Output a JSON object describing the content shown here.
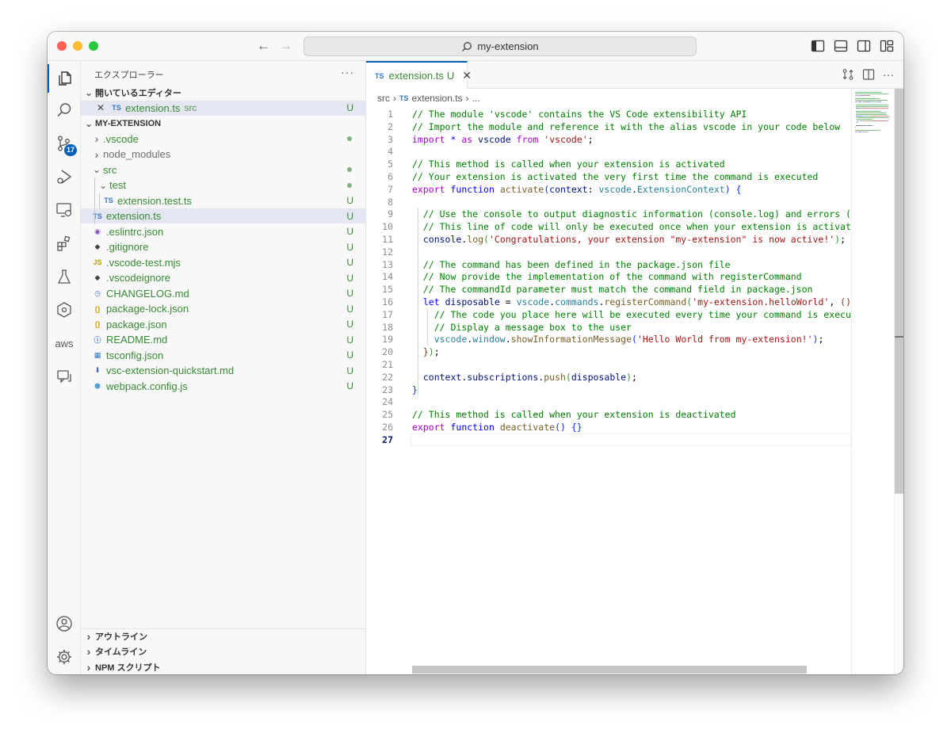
{
  "window": {
    "search_text": "my-extension"
  },
  "activity": {
    "scm_badge": "17",
    "aws_label": "aws"
  },
  "sidebar": {
    "title": "エクスプローラー",
    "more": "···",
    "open_editors_label": "開いているエディター",
    "open_editors": [
      {
        "icon": "TS",
        "name": "extension.ts",
        "sub": "src",
        "status": "U"
      }
    ],
    "project_label": "MY-EXTENSION",
    "tree": [
      {
        "kind": "folder",
        "name": ".vscode",
        "status": "dot"
      },
      {
        "kind": "folder",
        "name": "node_modules",
        "status": ""
      },
      {
        "kind": "folder-open",
        "name": "src",
        "status": "dot"
      },
      {
        "kind": "folder-open",
        "name": "test",
        "status": "dot"
      },
      {
        "kind": "file",
        "icon": "TS",
        "name": "extension.test.ts",
        "status": "U"
      },
      {
        "kind": "file",
        "icon": "TS",
        "name": "extension.ts",
        "status": "U"
      },
      {
        "kind": "file",
        "icon": "eslint",
        "name": ".eslintrc.json",
        "status": "U"
      },
      {
        "kind": "file",
        "icon": "git",
        "name": ".gitignore",
        "status": "U"
      },
      {
        "kind": "file",
        "icon": "JS",
        "name": ".vscode-test.mjs",
        "status": "U"
      },
      {
        "kind": "file",
        "icon": "git",
        "name": ".vscodeignore",
        "status": "U"
      },
      {
        "kind": "file",
        "icon": "clock",
        "name": "CHANGELOG.md",
        "status": "U"
      },
      {
        "kind": "file",
        "icon": "json",
        "name": "package-lock.json",
        "status": "U"
      },
      {
        "kind": "file",
        "icon": "json",
        "name": "package.json",
        "status": "U"
      },
      {
        "kind": "file",
        "icon": "info",
        "name": "README.md",
        "status": "U"
      },
      {
        "kind": "file",
        "icon": "tsconfig",
        "name": "tsconfig.json",
        "status": "U"
      },
      {
        "kind": "file",
        "icon": "md-down",
        "name": "vsc-extension-quickstart.md",
        "status": "U"
      },
      {
        "kind": "file",
        "icon": "webpack",
        "name": "webpack.config.js",
        "status": "U"
      }
    ],
    "bottom_sections": [
      "アウトライン",
      "タイムライン",
      "NPM スクリプト"
    ]
  },
  "editor": {
    "tab": {
      "icon": "TS",
      "name": "extension.ts",
      "status": "U",
      "close": "✕"
    },
    "breadcrumb": {
      "folder": "src",
      "icon": "TS",
      "file": "extension.ts",
      "more": "..."
    },
    "current_line": 27,
    "lines": [
      [
        [
          "cm",
          "// The module 'vscode' contains the VS Code extensibility API"
        ]
      ],
      [
        [
          "cm",
          "// Import the module and reference it with the alias vscode in your code below"
        ]
      ],
      [
        [
          "kw",
          "import"
        ],
        [
          "pl",
          " "
        ],
        [
          "kb",
          "*"
        ],
        [
          "pl",
          " "
        ],
        [
          "kw",
          "as"
        ],
        [
          "pl",
          " "
        ],
        [
          "var",
          "vscode"
        ],
        [
          "pl",
          " "
        ],
        [
          "kw",
          "from"
        ],
        [
          "pl",
          " "
        ],
        [
          "str",
          "'vscode'"
        ],
        [
          "pl",
          ";"
        ]
      ],
      [],
      [
        [
          "cm",
          "// This method is called when your extension is activated"
        ]
      ],
      [
        [
          "cm",
          "// Your extension is activated the very first time the command is executed"
        ]
      ],
      [
        [
          "kw",
          "export"
        ],
        [
          "pl",
          " "
        ],
        [
          "kb",
          "function"
        ],
        [
          "pl",
          " "
        ],
        [
          "fn",
          "activate"
        ],
        [
          "br",
          "("
        ],
        [
          "var",
          "context"
        ],
        [
          "pl",
          ": "
        ],
        [
          "ty",
          "vscode"
        ],
        [
          "pl",
          "."
        ],
        [
          "ty",
          "ExtensionContext"
        ],
        [
          "br",
          ")"
        ],
        [
          "pl",
          " "
        ],
        [
          "br",
          "{"
        ]
      ],
      [],
      [
        [
          "pl",
          "  "
        ],
        [
          "cm",
          "// Use the console to output diagnostic information (console.log) and errors (console.error)"
        ]
      ],
      [
        [
          "pl",
          "  "
        ],
        [
          "cm",
          "// This line of code will only be executed once when your extension is activated"
        ]
      ],
      [
        [
          "pl",
          "  "
        ],
        [
          "var",
          "console"
        ],
        [
          "pl",
          "."
        ],
        [
          "fn",
          "log"
        ],
        [
          "br2",
          "("
        ],
        [
          "str",
          "'Congratulations, your extension \"my-extension\" is now active!'"
        ],
        [
          "br2",
          ")"
        ],
        [
          "pl",
          ";"
        ]
      ],
      [],
      [
        [
          "pl",
          "  "
        ],
        [
          "cm",
          "// The command has been defined in the package.json file"
        ]
      ],
      [
        [
          "pl",
          "  "
        ],
        [
          "cm",
          "// Now provide the implementation of the command with registerCommand"
        ]
      ],
      [
        [
          "pl",
          "  "
        ],
        [
          "cm",
          "// The commandId parameter must match the command field in package.json"
        ]
      ],
      [
        [
          "pl",
          "  "
        ],
        [
          "kb",
          "let"
        ],
        [
          "pl",
          " "
        ],
        [
          "var",
          "disposable"
        ],
        [
          "pl",
          " = "
        ],
        [
          "ty",
          "vscode"
        ],
        [
          "pl",
          "."
        ],
        [
          "ty",
          "commands"
        ],
        [
          "pl",
          "."
        ],
        [
          "fn",
          "registerCommand"
        ],
        [
          "br2",
          "("
        ],
        [
          "str",
          "'my-extension.helloWorld'"
        ],
        [
          "pl",
          ", "
        ],
        [
          "br3",
          "()"
        ],
        [
          "pl",
          " "
        ],
        [
          "kb",
          "=>"
        ],
        [
          "pl",
          " "
        ],
        [
          "br3",
          "{"
        ]
      ],
      [
        [
          "pl",
          "    "
        ],
        [
          "cm",
          "// The code you place here will be executed every time your command is executed"
        ]
      ],
      [
        [
          "pl",
          "    "
        ],
        [
          "cm",
          "// Display a message box to the user"
        ]
      ],
      [
        [
          "pl",
          "    "
        ],
        [
          "ty",
          "vscode"
        ],
        [
          "pl",
          "."
        ],
        [
          "ty",
          "window"
        ],
        [
          "pl",
          "."
        ],
        [
          "fn",
          "showInformationMessage"
        ],
        [
          "br",
          "("
        ],
        [
          "str",
          "'Hello World from my-extension!'"
        ],
        [
          "br",
          ")"
        ],
        [
          "pl",
          ";"
        ]
      ],
      [
        [
          "pl",
          "  "
        ],
        [
          "br3",
          "}"
        ],
        [
          "br2",
          ")"
        ],
        [
          "pl",
          ";"
        ]
      ],
      [],
      [
        [
          "pl",
          "  "
        ],
        [
          "var",
          "context"
        ],
        [
          "pl",
          "."
        ],
        [
          "var",
          "subscriptions"
        ],
        [
          "pl",
          "."
        ],
        [
          "fn",
          "push"
        ],
        [
          "br2",
          "("
        ],
        [
          "var",
          "disposable"
        ],
        [
          "br2",
          ")"
        ],
        [
          "pl",
          ";"
        ]
      ],
      [
        [
          "br",
          "}"
        ]
      ],
      [],
      [
        [
          "cm",
          "// This method is called when your extension is deactivated"
        ]
      ],
      [
        [
          "kw",
          "export"
        ],
        [
          "pl",
          " "
        ],
        [
          "kb",
          "function"
        ],
        [
          "pl",
          " "
        ],
        [
          "fn",
          "deactivate"
        ],
        [
          "br",
          "()"
        ],
        [
          "pl",
          " "
        ],
        [
          "br",
          "{}"
        ]
      ],
      []
    ]
  },
  "colors": {
    "accent": "#005fb8",
    "git_untracked": "#388a34",
    "selection": "#e4e6f1"
  }
}
